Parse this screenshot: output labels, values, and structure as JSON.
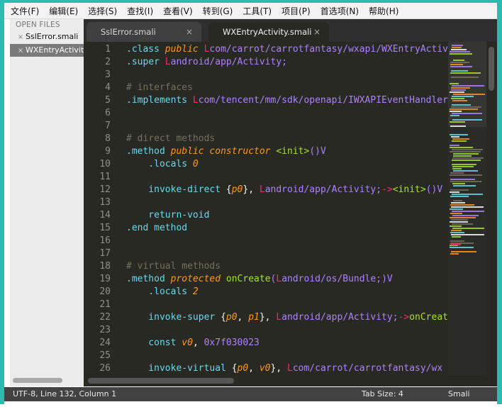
{
  "menu": [
    "文件(F)",
    "编辑(E)",
    "选择(S)",
    "查找(I)",
    "查看(V)",
    "转到(G)",
    "工具(T)",
    "项目(P)",
    "首选项(N)",
    "帮助(H)"
  ],
  "sidebar": {
    "title": "OPEN FILES",
    "files": [
      {
        "label": "SslError.smali",
        "close": "×"
      },
      {
        "label": "WXEntryActivity.smali",
        "close": "×"
      }
    ]
  },
  "tabs": [
    {
      "label": "SslError.smali",
      "close": "×",
      "active": false
    },
    {
      "label": "WXEntryActivity.smali",
      "close": "×",
      "active": true
    }
  ],
  "editor": {
    "lines": [
      [
        {
          "t": ".class ",
          "c": "kw"
        },
        {
          "t": "public ",
          "c": "it"
        },
        {
          "t": "L",
          "c": "cls"
        },
        {
          "t": "com/carrot/carrotfantasy/wxapi/WXEntryActivity;",
          "c": "cl"
        }
      ],
      [
        {
          "t": ".super ",
          "c": "kw"
        },
        {
          "t": "L",
          "c": "cls"
        },
        {
          "t": "android/app/Activity;",
          "c": "cl"
        }
      ],
      [],
      [
        {
          "t": "# interfaces",
          "c": "cm"
        }
      ],
      [
        {
          "t": ".implements ",
          "c": "kw"
        },
        {
          "t": "L",
          "c": "cls"
        },
        {
          "t": "com/tencent/mm/sdk/openapi/IWXAPIEventHandler;",
          "c": "cl"
        }
      ],
      [],
      [],
      [
        {
          "t": "# direct methods",
          "c": "cm"
        }
      ],
      [
        {
          "t": ".method ",
          "c": "kw"
        },
        {
          "t": "public constructor ",
          "c": "it"
        },
        {
          "t": "<init>",
          "c": "fn"
        },
        {
          "t": "()V",
          "c": "cl"
        }
      ],
      [
        {
          "t": "    .locals ",
          "c": "kw"
        },
        {
          "t": "0",
          "c": "it"
        }
      ],
      [],
      [
        {
          "t": "    invoke-direct ",
          "c": "kw"
        },
        {
          "t": "{",
          "c": "pl"
        },
        {
          "t": "p0",
          "c": "it"
        },
        {
          "t": "}, ",
          "c": "pl"
        },
        {
          "t": "L",
          "c": "cls"
        },
        {
          "t": "android/app/Activity;",
          "c": "cl"
        },
        {
          "t": "->",
          "c": "cls"
        },
        {
          "t": "<init>",
          "c": "fn"
        },
        {
          "t": "()V",
          "c": "cl"
        }
      ],
      [],
      [
        {
          "t": "    return-void",
          "c": "kw"
        }
      ],
      [
        {
          "t": ".end method",
          "c": "kw"
        }
      ],
      [],
      [],
      [
        {
          "t": "# virtual methods",
          "c": "cm"
        }
      ],
      [
        {
          "t": ".method ",
          "c": "kw"
        },
        {
          "t": "protected ",
          "c": "it"
        },
        {
          "t": "onCreate",
          "c": "fn"
        },
        {
          "t": "(",
          "c": "cl"
        },
        {
          "t": "L",
          "c": "cls"
        },
        {
          "t": "android/os/Bundle;",
          "c": "cl"
        },
        {
          "t": ")V",
          "c": "cl"
        }
      ],
      [
        {
          "t": "    .locals ",
          "c": "kw"
        },
        {
          "t": "2",
          "c": "it"
        }
      ],
      [],
      [
        {
          "t": "    invoke-super ",
          "c": "kw"
        },
        {
          "t": "{",
          "c": "pl"
        },
        {
          "t": "p0",
          "c": "it"
        },
        {
          "t": ", ",
          "c": "pl"
        },
        {
          "t": "p1",
          "c": "it"
        },
        {
          "t": "}, ",
          "c": "pl"
        },
        {
          "t": "L",
          "c": "cls"
        },
        {
          "t": "android/app/Activity;",
          "c": "cl"
        },
        {
          "t": "->",
          "c": "cls"
        },
        {
          "t": "onCreate",
          "c": "fn"
        }
      ],
      [],
      [
        {
          "t": "    const ",
          "c": "kw"
        },
        {
          "t": "v0",
          "c": "it"
        },
        {
          "t": ", ",
          "c": "pl"
        },
        {
          "t": "0x7f030023",
          "c": "cl"
        }
      ],
      [],
      [
        {
          "t": "    invoke-virtual ",
          "c": "kw"
        },
        {
          "t": "{",
          "c": "pl"
        },
        {
          "t": "p0",
          "c": "it"
        },
        {
          "t": ", ",
          "c": "pl"
        },
        {
          "t": "v0",
          "c": "it"
        },
        {
          "t": "}, ",
          "c": "pl"
        },
        {
          "t": "L",
          "c": "cls"
        },
        {
          "t": "com/carrot/carrotfantasy/wx",
          "c": "cl"
        }
      ]
    ]
  },
  "status": {
    "position": "UTF-8, Line 132, Column 1",
    "tab_size": "Tab Size: 4",
    "syntax": "Smali"
  },
  "colors": {
    "editor_bg": "#282923",
    "keyword": "#66d9ef",
    "storage": "#fd971f",
    "class_path": "#ae81ff",
    "class_prefix": "#f92672",
    "comment": "#75715e",
    "function": "#a6e22e",
    "window_frame": "#2dbbb0"
  },
  "icons": {
    "close": "close-icon"
  }
}
